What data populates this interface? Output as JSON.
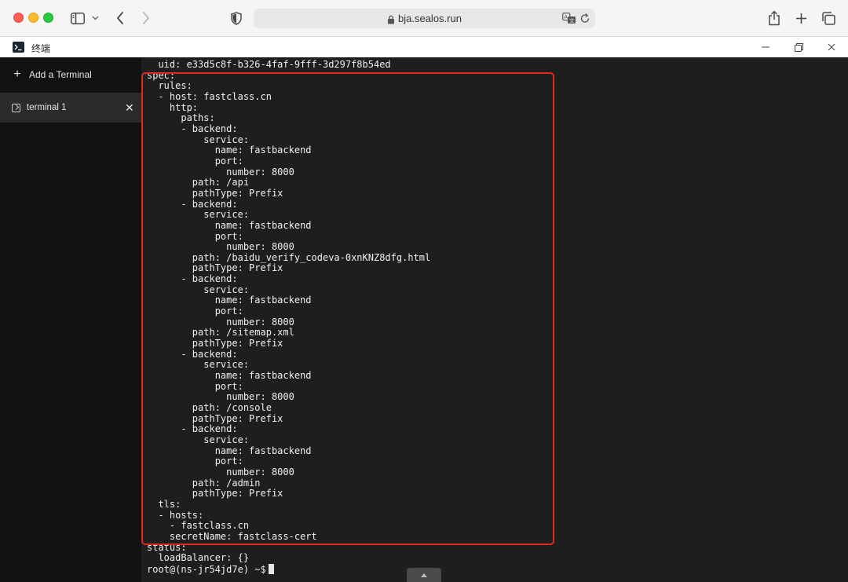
{
  "browser": {
    "url": "bja.sealos.run",
    "icons": [
      "sidebar-icon",
      "chevron-down-icon",
      "back-icon",
      "forward-icon",
      "shield-icon",
      "lock-icon",
      "translate-icon",
      "reload-icon",
      "share-icon",
      "plus-icon",
      "tabs-icon"
    ]
  },
  "app": {
    "title": "终端"
  },
  "sidebar": {
    "add_label": "Add a Terminal",
    "tabs": [
      {
        "label": "terminal 1",
        "close": "✕"
      }
    ]
  },
  "terminal": {
    "lines": [
      "  uid: e33d5c8f-b326-4faf-9fff-3d297f8b54ed",
      "spec:",
      "  rules:",
      "  - host: fastclass.cn",
      "    http:",
      "      paths:",
      "      - backend:",
      "          service:",
      "            name: fastbackend",
      "            port:",
      "              number: 8000",
      "        path: /api",
      "        pathType: Prefix",
      "      - backend:",
      "          service:",
      "            name: fastbackend",
      "            port:",
      "              number: 8000",
      "        path: /baidu_verify_codeva-0xnKNZ8dfg.html",
      "        pathType: Prefix",
      "      - backend:",
      "          service:",
      "            name: fastbackend",
      "            port:",
      "              number: 8000",
      "        path: /sitemap.xml",
      "        pathType: Prefix",
      "      - backend:",
      "          service:",
      "            name: fastbackend",
      "            port:",
      "              number: 8000",
      "        path: /console",
      "        pathType: Prefix",
      "      - backend:",
      "          service:",
      "            name: fastbackend",
      "            port:",
      "              number: 8000",
      "        path: /admin",
      "        pathType: Prefix",
      "  tls:",
      "  - hosts:",
      "    - fastclass.cn",
      "    secretName: fastclass-cert",
      "status:",
      "  loadBalancer: {}"
    ],
    "prompt": "root@(ns-jr54jd7e) ~$",
    "highlight_color": "#e0281f"
  }
}
